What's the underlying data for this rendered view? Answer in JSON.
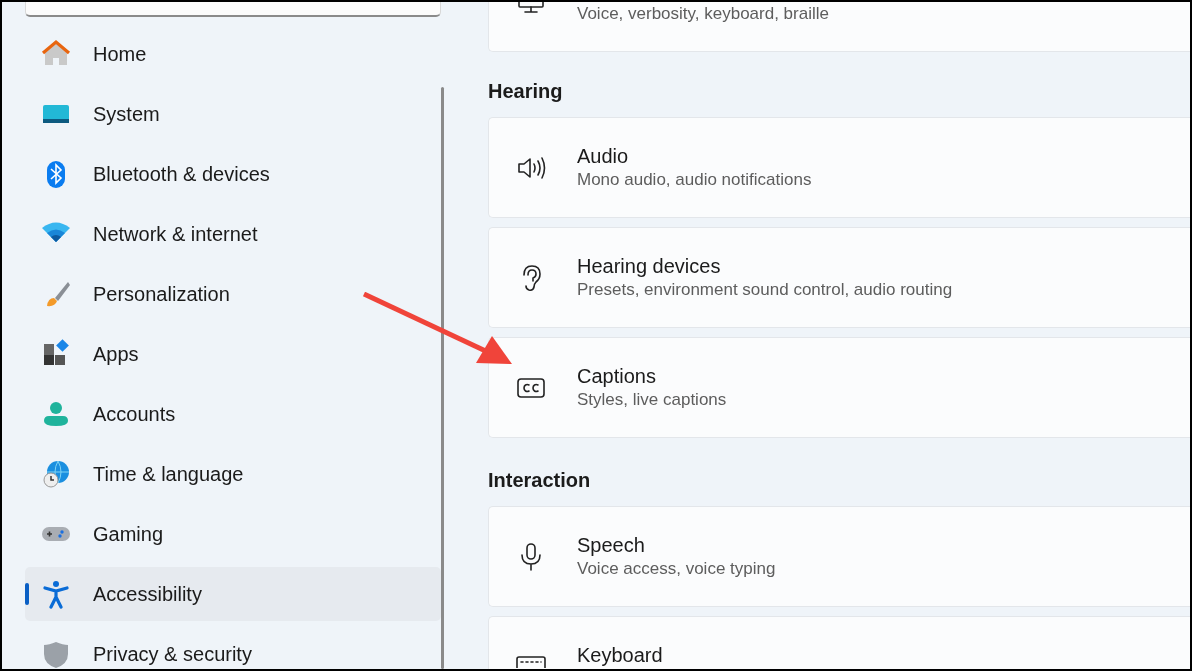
{
  "sidebar": {
    "items": [
      {
        "label": "Home",
        "kind": "home",
        "selected": false
      },
      {
        "label": "System",
        "kind": "system",
        "selected": false
      },
      {
        "label": "Bluetooth & devices",
        "kind": "bluetooth",
        "selected": false
      },
      {
        "label": "Network & internet",
        "kind": "wifi",
        "selected": false
      },
      {
        "label": "Personalization",
        "kind": "brush",
        "selected": false
      },
      {
        "label": "Apps",
        "kind": "apps",
        "selected": false
      },
      {
        "label": "Accounts",
        "kind": "person",
        "selected": false
      },
      {
        "label": "Time & language",
        "kind": "globe",
        "selected": false
      },
      {
        "label": "Gaming",
        "kind": "gamepad",
        "selected": false
      },
      {
        "label": "Accessibility",
        "kind": "accessibility",
        "selected": true
      },
      {
        "label": "Privacy & security",
        "kind": "shield",
        "selected": false
      }
    ]
  },
  "sections": [
    {
      "cards": [
        {
          "kind": "monitor",
          "subtitle": "Voice, verbosity, keyboard, braille"
        }
      ]
    },
    {
      "heading": "Hearing",
      "cards": [
        {
          "kind": "speaker",
          "title": "Audio",
          "subtitle": "Mono audio, audio notifications"
        },
        {
          "kind": "ear",
          "title": "Hearing devices",
          "subtitle": "Presets, environment sound control, audio routing"
        },
        {
          "kind": "cc",
          "title": "Captions",
          "subtitle": "Styles, live captions"
        }
      ]
    },
    {
      "heading": "Interaction",
      "cards": [
        {
          "kind": "mic",
          "title": "Speech",
          "subtitle": "Voice access, voice typing"
        },
        {
          "kind": "keyboard",
          "title": "Keyboard"
        }
      ]
    }
  ]
}
